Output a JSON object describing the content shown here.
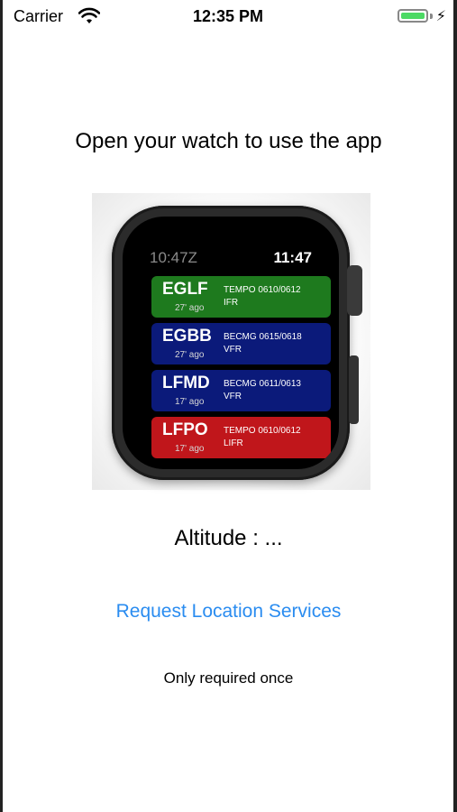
{
  "status_bar": {
    "carrier": "Carrier",
    "time": "12:35 PM",
    "battery_color": "#4cd964"
  },
  "main": {
    "heading": "Open your watch to use the app",
    "altitude": "Altitude :  ...",
    "request_button": "Request Location Services",
    "note": "Only required once",
    "link_color": "#2a8cf0"
  },
  "watch": {
    "time_zulu": "10:47Z",
    "time_local": "11:47",
    "rows": [
      {
        "code": "EGLF",
        "age": "27' ago",
        "forecast": "TEMPO 0610/0612",
        "category": "IFR",
        "color": "#1e7a1e"
      },
      {
        "code": "EGBB",
        "age": "27' ago",
        "forecast": "BECMG 0615/0618",
        "category": "VFR",
        "color": "#0b1a7a"
      },
      {
        "code": "LFMD",
        "age": "17' ago",
        "forecast": "BECMG 0611/0613",
        "category": "VFR",
        "color": "#0b1a7a"
      },
      {
        "code": "LFPO",
        "age": "17' ago",
        "forecast": "TEMPO 0610/0612",
        "category": "LIFR",
        "color": "#c0161b"
      }
    ]
  }
}
